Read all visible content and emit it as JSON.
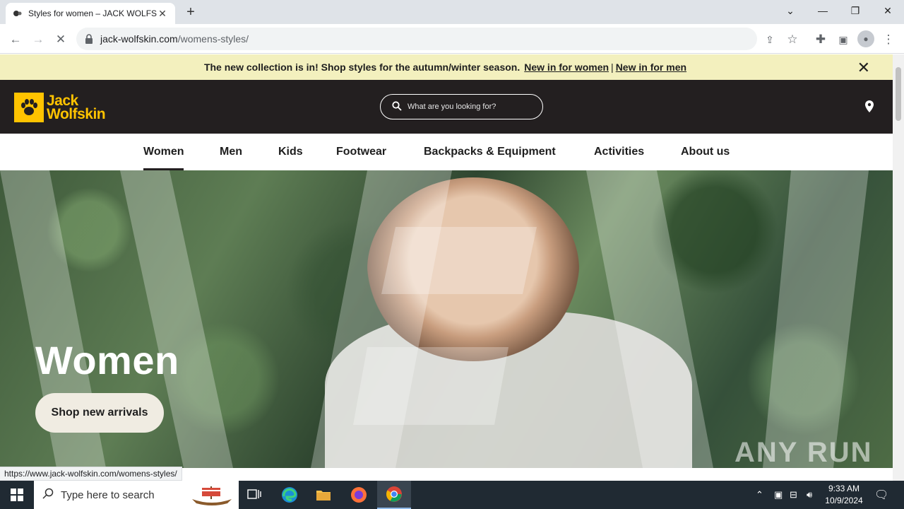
{
  "browser": {
    "tab_title": "Styles for women – JACK WOLFSKIN",
    "url_host": "jack-wolfskin.com",
    "url_path": "/womens-styles/",
    "status_url": "https://www.jack-wolfskin.com/womens-styles/"
  },
  "banner": {
    "text": "The new collection is in! Shop styles for the autumn/winter season.",
    "link_women": "New in for women",
    "separator": "|",
    "link_men": "New in for men"
  },
  "header": {
    "brand_line1": "Jack",
    "brand_line2": "Wolfskin",
    "search_placeholder": "What are you looking for?"
  },
  "nav": {
    "items": [
      "Women",
      "Men",
      "Kids",
      "Footwear",
      "Backpacks & Equipment",
      "Activities",
      "About us"
    ],
    "active": "Women"
  },
  "hero": {
    "title": "Women",
    "button": "Shop new arrivals"
  },
  "watermark": "ANY RUN",
  "taskbar": {
    "search_placeholder": "Type here to search",
    "time": "9:33 AM",
    "date": "10/9/2024"
  },
  "colors": {
    "brand_yellow": "#ffc300",
    "header_bg": "#231f20",
    "banner_bg": "#f3f0be"
  }
}
